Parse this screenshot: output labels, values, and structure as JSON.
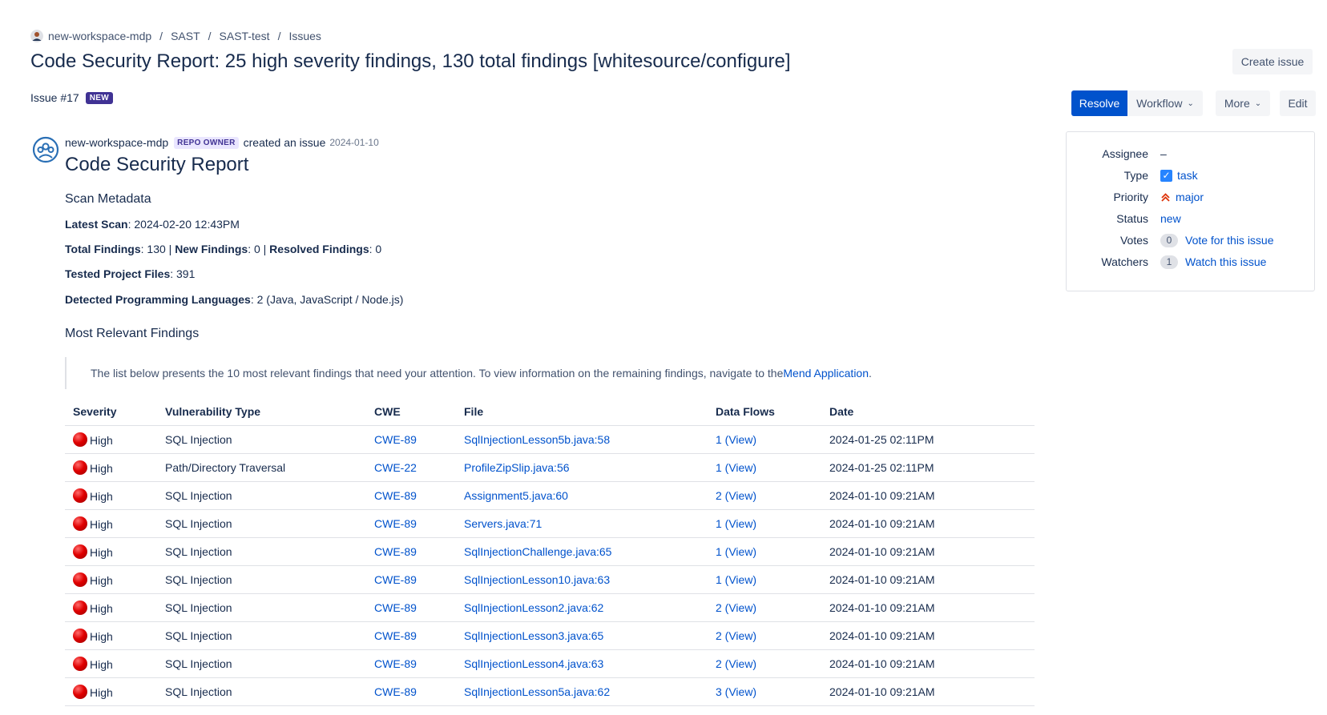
{
  "breadcrumb": {
    "items": [
      "new-workspace-mdp",
      "SAST",
      "SAST-test",
      "Issues"
    ],
    "separator": "/"
  },
  "issue": {
    "title": "Code Security Report: 25 high severity findings, 130 total findings [whitesource/configure]",
    "number": "Issue #17",
    "status_badge": "NEW"
  },
  "actions": {
    "create_issue": "Create issue",
    "resolve": "Resolve",
    "workflow": "Workflow",
    "more": "More",
    "edit": "Edit"
  },
  "author": {
    "name": "new-workspace-mdp",
    "role_badge": "REPO OWNER",
    "action": "created an issue",
    "date": "2024-01-10"
  },
  "report": {
    "heading": "Code Security Report",
    "scan_metadata_title": "Scan Metadata",
    "latest_scan_label": "Latest Scan",
    "latest_scan_value": ": 2024-02-20 12:43PM",
    "total_findings_label": "Total Findings",
    "total_findings_value": ": 130 | ",
    "new_findings_label": "New Findings",
    "new_findings_value": ": 0 | ",
    "resolved_findings_label": "Resolved Findings",
    "resolved_findings_value": ": 0",
    "tested_files_label": "Tested Project Files",
    "tested_files_value": ": 391",
    "languages_label": "Detected Programming Languages",
    "languages_value": ": 2 (Java, JavaScript / Node.js)",
    "relevant_title": "Most Relevant Findings",
    "relevant_note": "The list below presents the 10 most relevant findings that need your attention. To view information on the remaining findings, navigate to the ",
    "relevant_link": "Mend Application",
    "relevant_note_end": "."
  },
  "table": {
    "headers": [
      "Severity",
      "Vulnerability Type",
      "CWE",
      "File",
      "Data Flows",
      "Date"
    ],
    "rows": [
      {
        "severity": "High",
        "type": "SQL Injection",
        "cwe": "CWE-89",
        "file": "SqlInjectionLesson5b.java:58",
        "flows": "1 (View)",
        "date": "2024-01-25 02:11PM"
      },
      {
        "severity": "High",
        "type": "Path/Directory Traversal",
        "cwe": "CWE-22",
        "file": "ProfileZipSlip.java:56",
        "flows": "1 (View)",
        "date": "2024-01-25 02:11PM"
      },
      {
        "severity": "High",
        "type": "SQL Injection",
        "cwe": "CWE-89",
        "file": "Assignment5.java:60",
        "flows": "2 (View)",
        "date": "2024-01-10 09:21AM"
      },
      {
        "severity": "High",
        "type": "SQL Injection",
        "cwe": "CWE-89",
        "file": "Servers.java:71",
        "flows": "1 (View)",
        "date": "2024-01-10 09:21AM"
      },
      {
        "severity": "High",
        "type": "SQL Injection",
        "cwe": "CWE-89",
        "file": "SqlInjectionChallenge.java:65",
        "flows": "1 (View)",
        "date": "2024-01-10 09:21AM"
      },
      {
        "severity": "High",
        "type": "SQL Injection",
        "cwe": "CWE-89",
        "file": "SqlInjectionLesson10.java:63",
        "flows": "1 (View)",
        "date": "2024-01-10 09:21AM"
      },
      {
        "severity": "High",
        "type": "SQL Injection",
        "cwe": "CWE-89",
        "file": "SqlInjectionLesson2.java:62",
        "flows": "2 (View)",
        "date": "2024-01-10 09:21AM"
      },
      {
        "severity": "High",
        "type": "SQL Injection",
        "cwe": "CWE-89",
        "file": "SqlInjectionLesson3.java:65",
        "flows": "2 (View)",
        "date": "2024-01-10 09:21AM"
      },
      {
        "severity": "High",
        "type": "SQL Injection",
        "cwe": "CWE-89",
        "file": "SqlInjectionLesson4.java:63",
        "flows": "2 (View)",
        "date": "2024-01-10 09:21AM"
      },
      {
        "severity": "High",
        "type": "SQL Injection",
        "cwe": "CWE-89",
        "file": "SqlInjectionLesson5a.java:62",
        "flows": "3 (View)",
        "date": "2024-01-10 09:21AM"
      }
    ]
  },
  "sidebar": {
    "assignee_label": "Assignee",
    "assignee_value": "–",
    "type_label": "Type",
    "type_value": "task",
    "priority_label": "Priority",
    "priority_value": "major",
    "status_label": "Status",
    "status_value": "new",
    "votes_label": "Votes",
    "votes_count": "0",
    "votes_link": "Vote for this issue",
    "watchers_label": "Watchers",
    "watchers_count": "1",
    "watchers_link": "Watch this issue"
  },
  "colors": {
    "primary": "#0052cc",
    "text": "#172b4d",
    "new_badge": "#403294",
    "owner_badge_bg": "#eae6ff",
    "high_severity": "#e00000"
  },
  "icons": {
    "severity": "red-circle-icon",
    "type": "checkbox-task-icon",
    "priority": "double-chevron-up-icon"
  }
}
